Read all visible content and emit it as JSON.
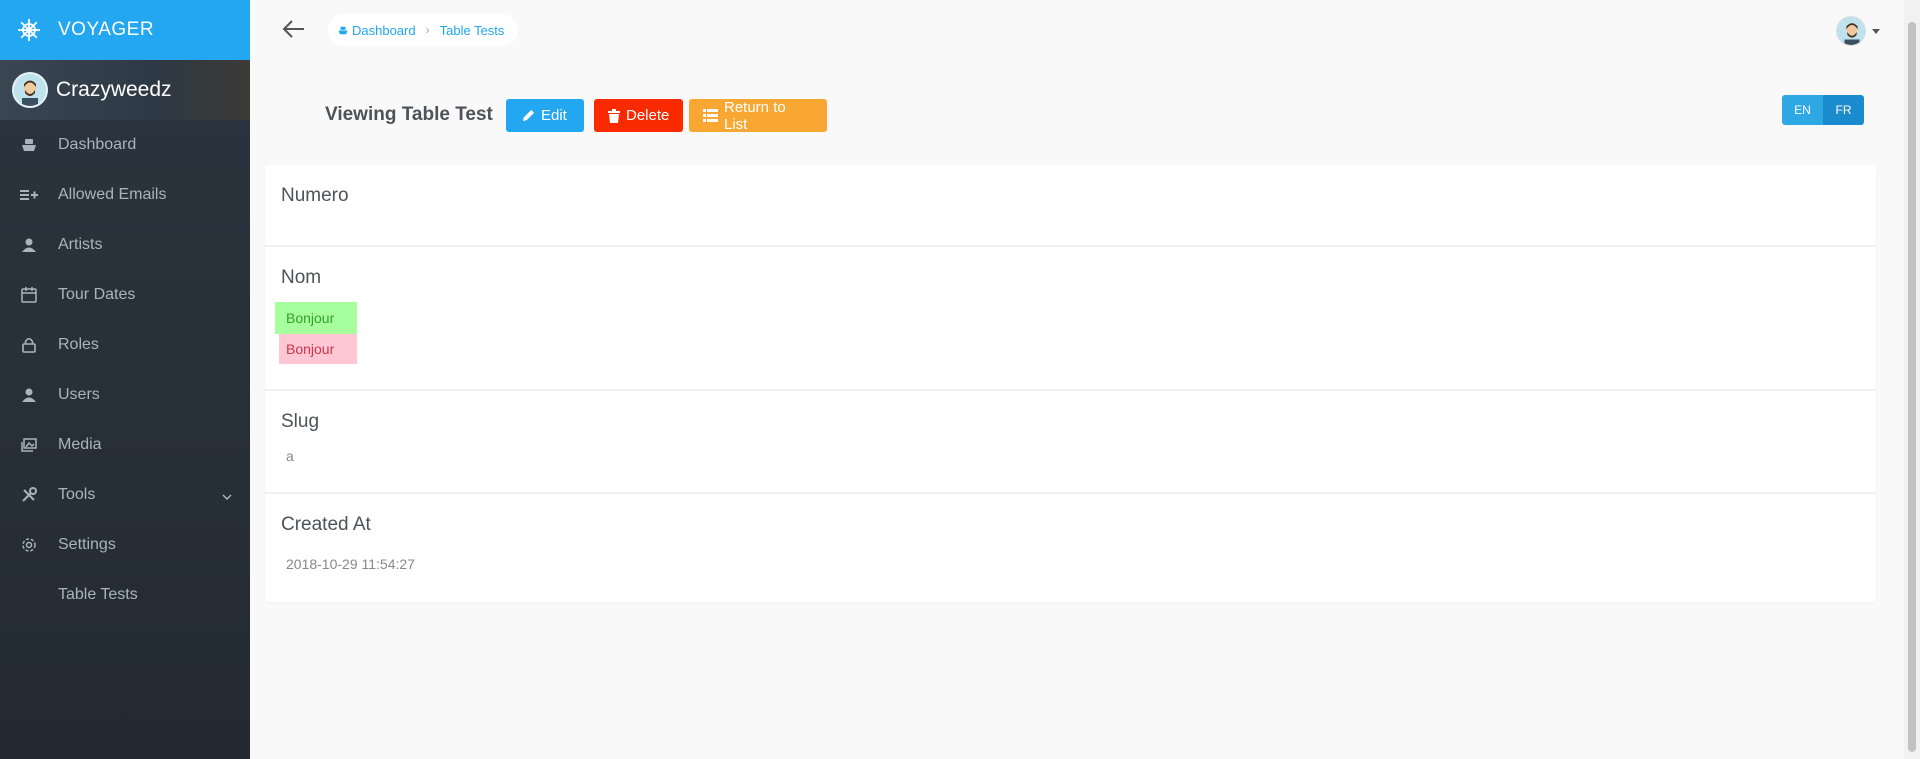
{
  "brand": {
    "title": "VOYAGER",
    "icon": "helm-icon"
  },
  "profile": {
    "name": "Crazyweedz"
  },
  "sidebar": {
    "items": [
      {
        "label": "Dashboard",
        "icon": "boat-icon"
      },
      {
        "label": "Allowed Emails",
        "icon": "list-add-icon"
      },
      {
        "label": "Artists",
        "icon": "person-icon"
      },
      {
        "label": "Tour Dates",
        "icon": "calendar-icon"
      },
      {
        "label": "Roles",
        "icon": "lock-icon"
      },
      {
        "label": "Users",
        "icon": "person-icon"
      },
      {
        "label": "Media",
        "icon": "images-icon"
      },
      {
        "label": "Tools",
        "icon": "tools-icon"
      },
      {
        "label": "Settings",
        "icon": "gear-icon"
      },
      {
        "label": "Table Tests",
        "icon": ""
      }
    ]
  },
  "breadcrumb": {
    "home": "Dashboard",
    "current": "Table Tests"
  },
  "page": {
    "title": "Viewing Table Test",
    "edit_label": "Edit",
    "delete_label": "Delete",
    "return_label": "Return to List"
  },
  "lang": {
    "en": "EN",
    "fr": "FR"
  },
  "fields": {
    "numero": {
      "label": "Numero",
      "value": ""
    },
    "nom": {
      "label": "Nom",
      "added": "Bonjour",
      "removed": "Bonjour"
    },
    "slug": {
      "label": "Slug",
      "value": "a"
    },
    "created_at": {
      "label": "Created At",
      "value": "2018-10-29 11:54:27"
    }
  },
  "colors": {
    "accent": "#22a7f0",
    "sidebar_bg": "#2a333d",
    "danger": "#fa2a00",
    "warning": "#f8a733",
    "diff_add_bg": "#a8ff9e",
    "diff_del_bg": "#ffc6d3"
  }
}
